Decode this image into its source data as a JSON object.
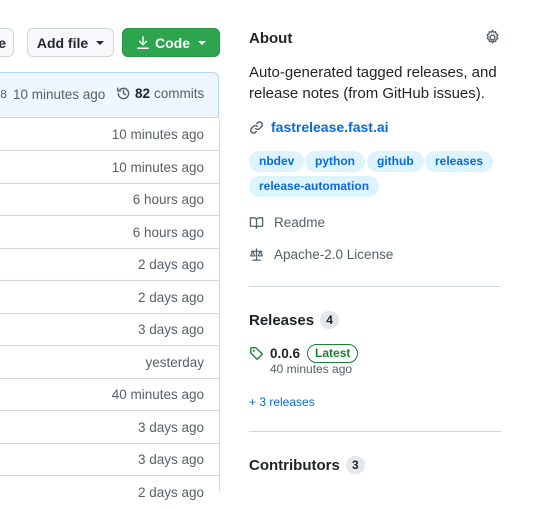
{
  "toolbar": {
    "partial_button_label": "e",
    "add_file_label": "Add file",
    "code_label": "Code"
  },
  "commit_bar": {
    "partial_hash": "8",
    "time": "10 minutes ago",
    "commits_count": "82",
    "commits_label": "commits"
  },
  "file_rows": [
    {
      "time": "10 minutes ago"
    },
    {
      "time": "10 minutes ago"
    },
    {
      "time": "6 hours ago"
    },
    {
      "time": "6 hours ago"
    },
    {
      "time": "2 days ago"
    },
    {
      "time": "2 days ago"
    },
    {
      "time": "3 days ago"
    },
    {
      "time": "yesterday"
    },
    {
      "time": "40 minutes ago"
    },
    {
      "time": "3 days ago"
    },
    {
      "time": "3 days ago"
    },
    {
      "time": "2 days ago"
    }
  ],
  "about": {
    "title": "About",
    "description": "Auto-generated tagged releases, and release notes (from GitHub issues).",
    "website": "fastrelease.fast.ai",
    "topics": [
      "nbdev",
      "python",
      "github",
      "releases",
      "release-automation"
    ],
    "readme_label": "Readme",
    "license_label": "Apache-2.0 License"
  },
  "releases": {
    "title": "Releases",
    "count": "4",
    "latest_tag": "0.0.6",
    "latest_badge": "Latest",
    "latest_time": "40 minutes ago",
    "more_link": "+ 3 releases"
  },
  "contributors": {
    "title": "Contributors",
    "count": "3"
  },
  "colors": {
    "accent_blue": "#0969da",
    "green_button": "#2da44e",
    "latest_green": "#1a7f37"
  }
}
